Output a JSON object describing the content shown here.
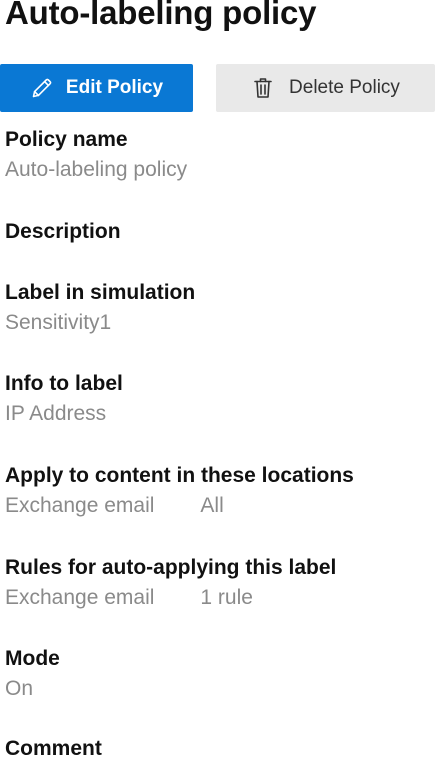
{
  "page": {
    "title": "Auto-labeling policy"
  },
  "toolbar": {
    "edit_label": "Edit Policy",
    "edit_icon": "pencil-icon",
    "delete_label": "Delete Policy",
    "delete_icon": "trash-icon",
    "accent_color": "#0a78d4"
  },
  "details": {
    "policy_name": {
      "label": "Policy name",
      "value": "Auto-labeling policy"
    },
    "description": {
      "label": "Description"
    },
    "label_in_simulation": {
      "label": "Label in simulation",
      "value": "Sensitivity1"
    },
    "info_to_label": {
      "label": "Info to label",
      "value": "IP Address"
    },
    "locations": {
      "label": "Apply to content in these locations",
      "location": "Exchange email",
      "scope": "All"
    },
    "rules": {
      "label": "Rules for auto-applying this label",
      "location": "Exchange email",
      "count": "1 rule"
    },
    "mode": {
      "label": "Mode",
      "value": "On"
    },
    "comment": {
      "label": "Comment"
    }
  }
}
